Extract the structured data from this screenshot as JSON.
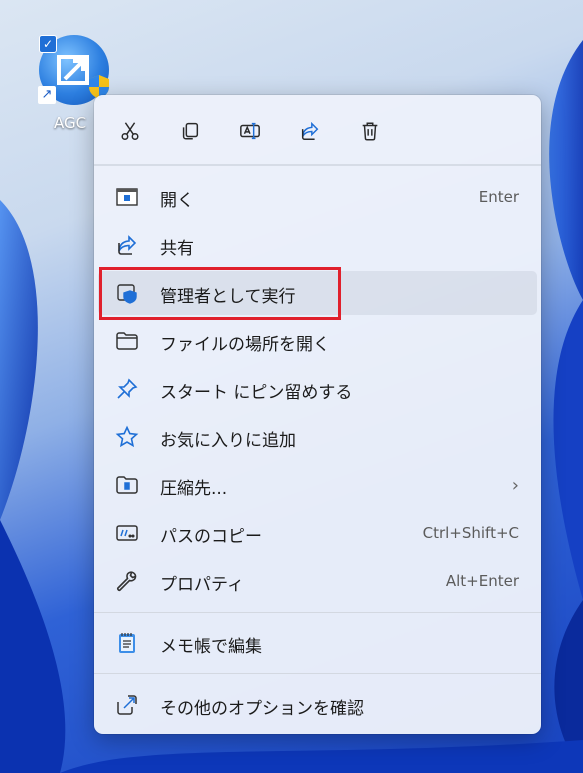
{
  "desktop": {
    "icon_label": "AGC",
    "icon_name": "app-shortcut-icon"
  },
  "toolbar": {
    "items": [
      {
        "name": "cut",
        "icon": "scissors-icon"
      },
      {
        "name": "copy",
        "icon": "copy-icon"
      },
      {
        "name": "rename",
        "icon": "rename-icon"
      },
      {
        "name": "share",
        "icon": "share-icon"
      },
      {
        "name": "delete",
        "icon": "trash-icon"
      }
    ]
  },
  "menu": {
    "items": [
      {
        "label": "開く",
        "accel": "Enter",
        "icon": "window-icon"
      },
      {
        "label": "共有",
        "accel": "",
        "icon": "share-icon"
      },
      {
        "label": "管理者として実行",
        "accel": "",
        "icon": "shield-icon",
        "highlighted": true
      },
      {
        "label": "ファイルの場所を開く",
        "accel": "",
        "icon": "folder-icon"
      },
      {
        "label": "スタート にピン留めする",
        "accel": "",
        "icon": "pin-icon"
      },
      {
        "label": "お気に入りに追加",
        "accel": "",
        "icon": "star-icon"
      },
      {
        "label": "圧縮先...",
        "accel": "",
        "icon": "zip-folder-icon",
        "submenu": true
      },
      {
        "label": "パスのコピー",
        "accel": "Ctrl+Shift+C",
        "icon": "path-icon"
      },
      {
        "label": "プロパティ",
        "accel": "Alt+Enter",
        "icon": "wrench-icon"
      },
      {
        "label": "メモ帳で編集",
        "accel": "",
        "icon": "notepad-icon"
      },
      {
        "label": "その他のオプションを確認",
        "accel": "",
        "icon": "more-options-icon"
      }
    ]
  },
  "colors": {
    "accent": "#1f6fd6",
    "highlight_box": "#e0202c"
  }
}
